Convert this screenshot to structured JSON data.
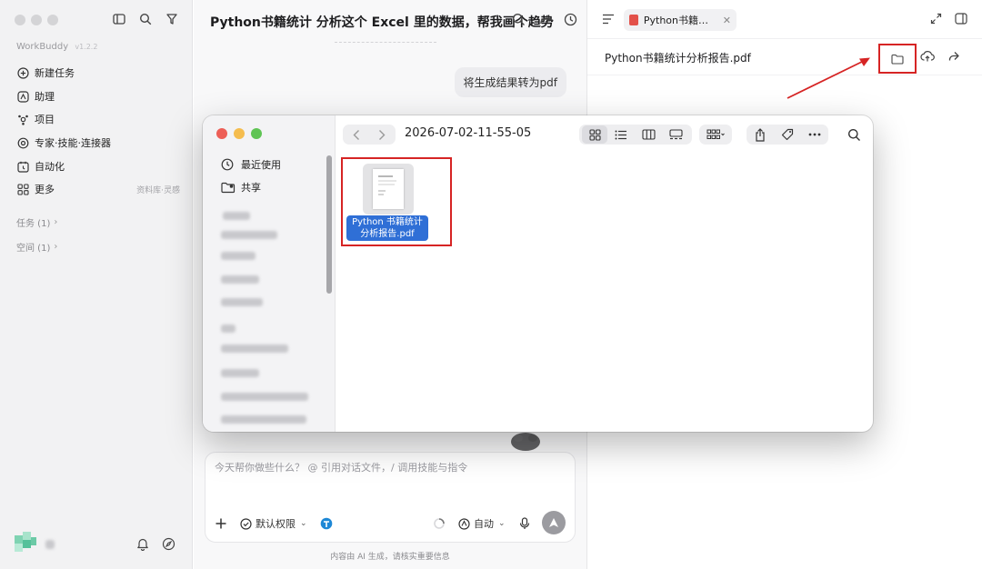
{
  "sidebar": {
    "app_name": "WorkBuddy",
    "version": "v1.2.2",
    "items": [
      {
        "label": "新建任务",
        "icon": "plus-circle-icon"
      },
      {
        "label": "助理",
        "icon": "assistant-icon"
      },
      {
        "label": "项目",
        "icon": "project-icon"
      },
      {
        "label": "专家·技能·连接器",
        "icon": "expert-icon"
      },
      {
        "label": "自动化",
        "icon": "automation-icon"
      },
      {
        "label": "更多",
        "icon": "more-grid-icon",
        "hint": "资料库·灵感"
      }
    ],
    "sections": [
      {
        "label": "任务 (1)"
      },
      {
        "label": "空间 (1)"
      }
    ]
  },
  "chat": {
    "title": "Python书籍统计 分析这个 Excel 里的数据，帮我画个趋势",
    "user_message": "将生成结果转为pdf",
    "input_placeholder": "今天帮你做些什么？ @ 引用对话文件，/ 调用技能与指令",
    "permission_label": "默认权限",
    "mode_label": "自动",
    "footnote": "内容由 AI 生成，请核实重要信息"
  },
  "panel": {
    "tab_title": "Python书籍统计分析报告.pdf",
    "file_title": "Python书籍统计分析报告.pdf"
  },
  "finder": {
    "path": "2026-07-02-11-55-05",
    "sidebar": [
      {
        "label": "最近使用",
        "icon": "clock-icon"
      },
      {
        "label": "共享",
        "icon": "shared-folder-icon"
      }
    ],
    "file": {
      "name": "Python 书籍统计分析报告.pdf"
    }
  },
  "colors": {
    "highlight": "#d62424",
    "selection": "#2f6fd6",
    "traffic_red": "#ed5f57",
    "traffic_yellow": "#f5bd4f",
    "traffic_green": "#5fc454"
  }
}
